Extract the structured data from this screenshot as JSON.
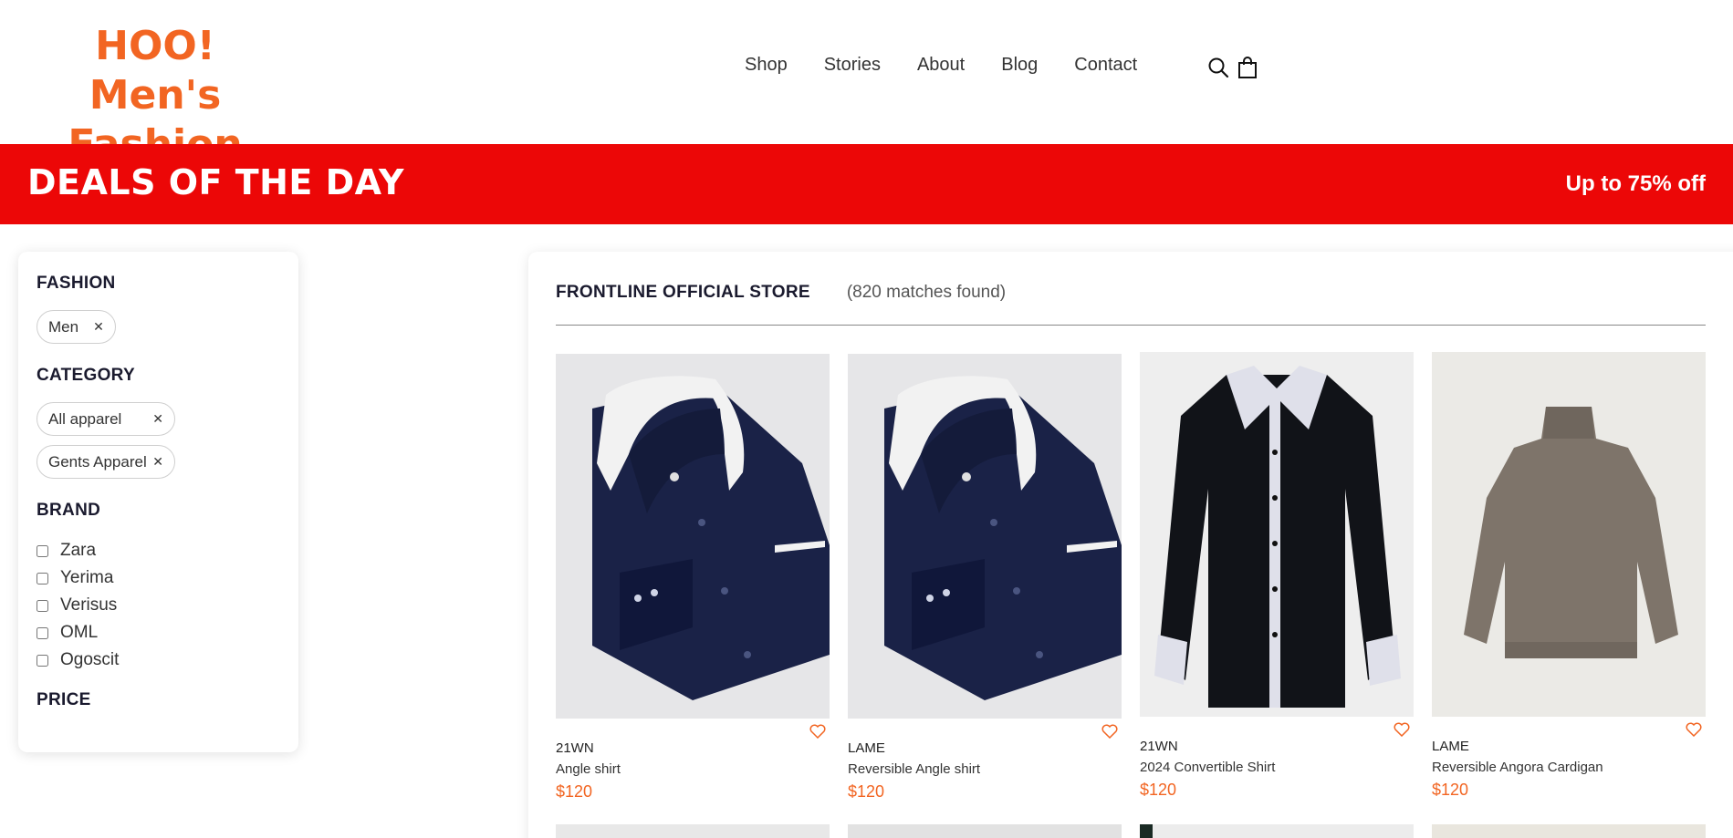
{
  "logo": {
    "line1": "HOO!",
    "line2": "Men's Fashion"
  },
  "nav": {
    "items": [
      "Shop",
      "Stories",
      "About",
      "Blog",
      "Contact"
    ]
  },
  "icons": {
    "search": "search-icon",
    "cart": "shopping-bag-icon"
  },
  "banner": {
    "title": "DEALS OF THE DAY",
    "offer": "Up to 75% off"
  },
  "colors": {
    "brand": "#f26522",
    "banner": "#ec0707"
  },
  "sidebar": {
    "fashion": {
      "heading": "FASHION",
      "chips": [
        "Men"
      ]
    },
    "category": {
      "heading": "CATEGORY",
      "chips": [
        "All apparel",
        "Gents Apparel"
      ]
    },
    "brand": {
      "heading": "BRAND",
      "items": [
        "Zara",
        "Yerima",
        "Verisus",
        "OML",
        "Ogoscit"
      ]
    },
    "price": {
      "heading": "PRICE"
    }
  },
  "store": {
    "name": "FRONTLINE OFFICIAL STORE",
    "count": "(820 matches found)"
  },
  "products": [
    {
      "brand": "21WN",
      "name": "Angle shirt",
      "price": "$120"
    },
    {
      "brand": "LAME",
      "name": "Reversible Angle shirt",
      "price": "$120"
    },
    {
      "brand": "21WN",
      "name": "2024 Convertible Shirt",
      "price": "$120"
    },
    {
      "brand": "LAME",
      "name": "Reversible Angora Cardigan",
      "price": "$120"
    }
  ]
}
